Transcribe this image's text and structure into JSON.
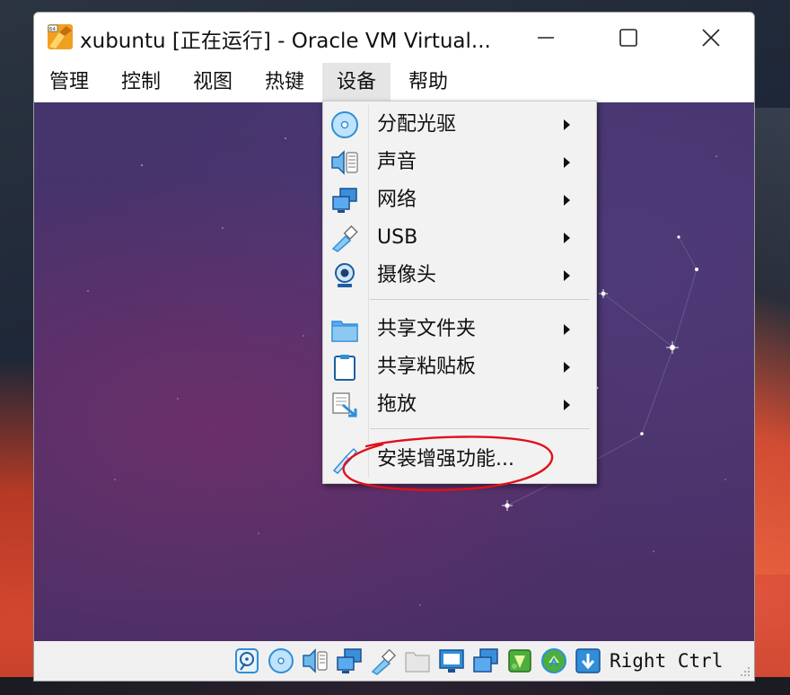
{
  "window": {
    "title": "xubuntu [正在运行] - Oracle VM Virtual...",
    "buttons": {
      "minimize": "minimize",
      "maximize": "maximize",
      "close": "close"
    }
  },
  "menubar": {
    "items": [
      {
        "label": "管理"
      },
      {
        "label": "控制"
      },
      {
        "label": "视图"
      },
      {
        "label": "热键"
      },
      {
        "label": "设备",
        "active": true
      },
      {
        "label": "帮助"
      }
    ]
  },
  "devices_menu": {
    "items": [
      {
        "label": "分配光驱",
        "icon": "optical-disk-icon",
        "submenu": true
      },
      {
        "label": "声音",
        "icon": "audio-icon",
        "submenu": true
      },
      {
        "label": "网络",
        "icon": "network-icon",
        "submenu": true
      },
      {
        "label": "USB",
        "icon": "usb-icon",
        "submenu": true
      },
      {
        "label": "摄像头",
        "icon": "webcam-icon",
        "submenu": true
      },
      {
        "label": "共享文件夹",
        "icon": "shared-folder-icon",
        "submenu": true
      },
      {
        "label": "共享粘贴板",
        "icon": "clipboard-icon",
        "submenu": true
      },
      {
        "label": "拖放",
        "icon": "drag-drop-icon",
        "submenu": true
      },
      {
        "label": "安装增强功能...",
        "icon": "guest-additions-icon",
        "submenu": false
      }
    ]
  },
  "statusbar": {
    "host_key": "Right Ctrl",
    "icons": [
      "hard-disk-icon",
      "optical-disk-icon",
      "audio-icon",
      "network-icon",
      "usb-icon",
      "shared-folder-icon",
      "display-icon",
      "video-capture-icon",
      "cpu-icon",
      "mouse-integration-icon",
      "keyboard-icon"
    ]
  },
  "colors": {
    "annotation_red": "#e0101a",
    "accent_blue": "#2f8fd8",
    "vm_background": "#4a3369"
  }
}
